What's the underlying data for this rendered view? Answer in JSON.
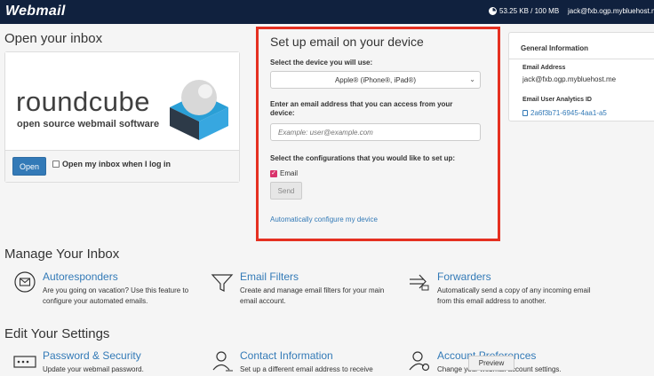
{
  "header": {
    "logo": "Webmail",
    "quota": "53.25 KB / 100 MB",
    "user": "jack@fxb.ogp.mybluehost.m"
  },
  "inbox": {
    "heading": "Open your inbox",
    "logo_word": "roundcube",
    "logo_tagline": "open source webmail software",
    "open_button": "Open",
    "open_on_login_label": "Open my inbox when I log in"
  },
  "setup": {
    "title": "Set up email on your device",
    "device_label": "Select the device you will use:",
    "device_selected": "Apple® (iPhone®, iPad®)",
    "email_label": "Enter an email address that you can access from your device:",
    "email_placeholder": "Example: user@example.com",
    "config_label": "Select the configurations that you would like to set up:",
    "email_checkbox_label": "Email",
    "send_button": "Send",
    "auto_link": "Automatically configure my device",
    "highlight_color": "#e53021"
  },
  "general_info": {
    "heading": "General Information",
    "email_label": "Email Address",
    "email_value": "jack@fxb.ogp.mybluehost.me",
    "analytics_label": "Email User Analytics ID",
    "analytics_value": "2a6f3b71-6945-4aa1-a5"
  },
  "manage": {
    "heading": "Manage Your Inbox",
    "items": [
      {
        "title": "Autoresponders",
        "desc": "Are you going on vacation? Use this feature to configure your automated emails."
      },
      {
        "title": "Email Filters",
        "desc": "Create and manage email filters for your main email account."
      },
      {
        "title": "Forwarders",
        "desc": "Automatically send a copy of any incoming email from this email address to another."
      }
    ]
  },
  "settings": {
    "heading": "Edit Your Settings",
    "items": [
      {
        "title": "Password & Security",
        "desc": "Update your webmail password."
      },
      {
        "title": "Contact Information",
        "desc": "Set up a different email address to receive"
      },
      {
        "title": "Account Preferences",
        "desc": "Change your webmail account settings."
      }
    ]
  },
  "tooltip": "Preview",
  "colors": {
    "topbar": "#10213e",
    "link": "#337ab7",
    "primary_button": "#337ab7"
  }
}
